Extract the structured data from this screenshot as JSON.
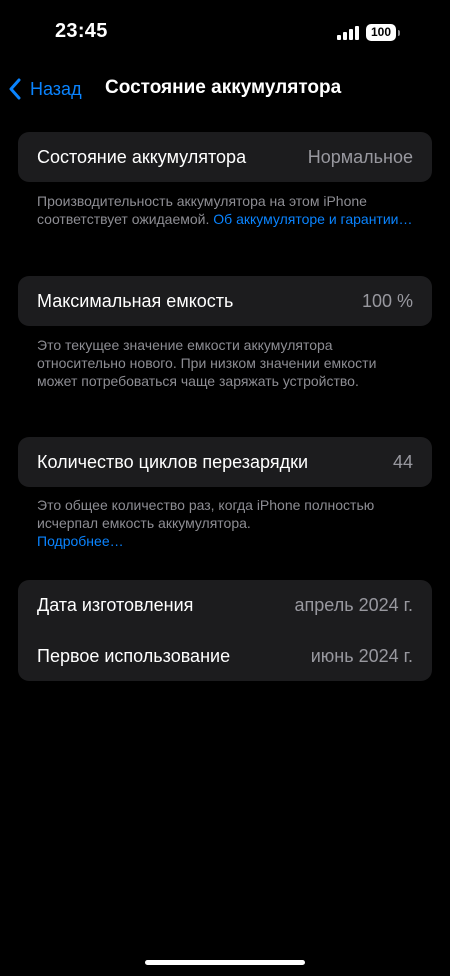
{
  "status_bar": {
    "time": "23:45",
    "battery_level": "100"
  },
  "nav": {
    "back_label": "Назад",
    "title": "Состояние аккумулятора"
  },
  "battery_health": {
    "label": "Состояние аккумулятора",
    "value": "Нормальное",
    "footnote_text": "Производительность аккумулятора на этом iPhone соответствует ожидаемой. ",
    "footnote_link": "Об аккумуляторе и гарантии…"
  },
  "max_capacity": {
    "label": "Максимальная емкость",
    "value": "100 %",
    "footnote": "Это текущее значение емкости аккумулятора относительно нового. При низком значении емкости может потребоваться чаще заряжать устройство."
  },
  "cycle_count": {
    "label": "Количество циклов перезарядки",
    "value": "44",
    "footnote_text": "Это общее количество раз, когда iPhone полностью исчерпал емкость аккумулятора.",
    "footnote_link": "Подробнее…"
  },
  "dates": {
    "manufacture_label": "Дата изготовления",
    "manufacture_value": "апрель 2024 г.",
    "first_use_label": "Первое использование",
    "first_use_value": "июнь 2024 г."
  },
  "icons": {
    "back": "chevron-left-icon",
    "signal": "cellular-signal-icon",
    "battery": "battery-icon"
  },
  "colors": {
    "accent": "#0a84ff",
    "background": "#000000",
    "card": "#1c1c1e",
    "secondary_text": "#98989f"
  }
}
